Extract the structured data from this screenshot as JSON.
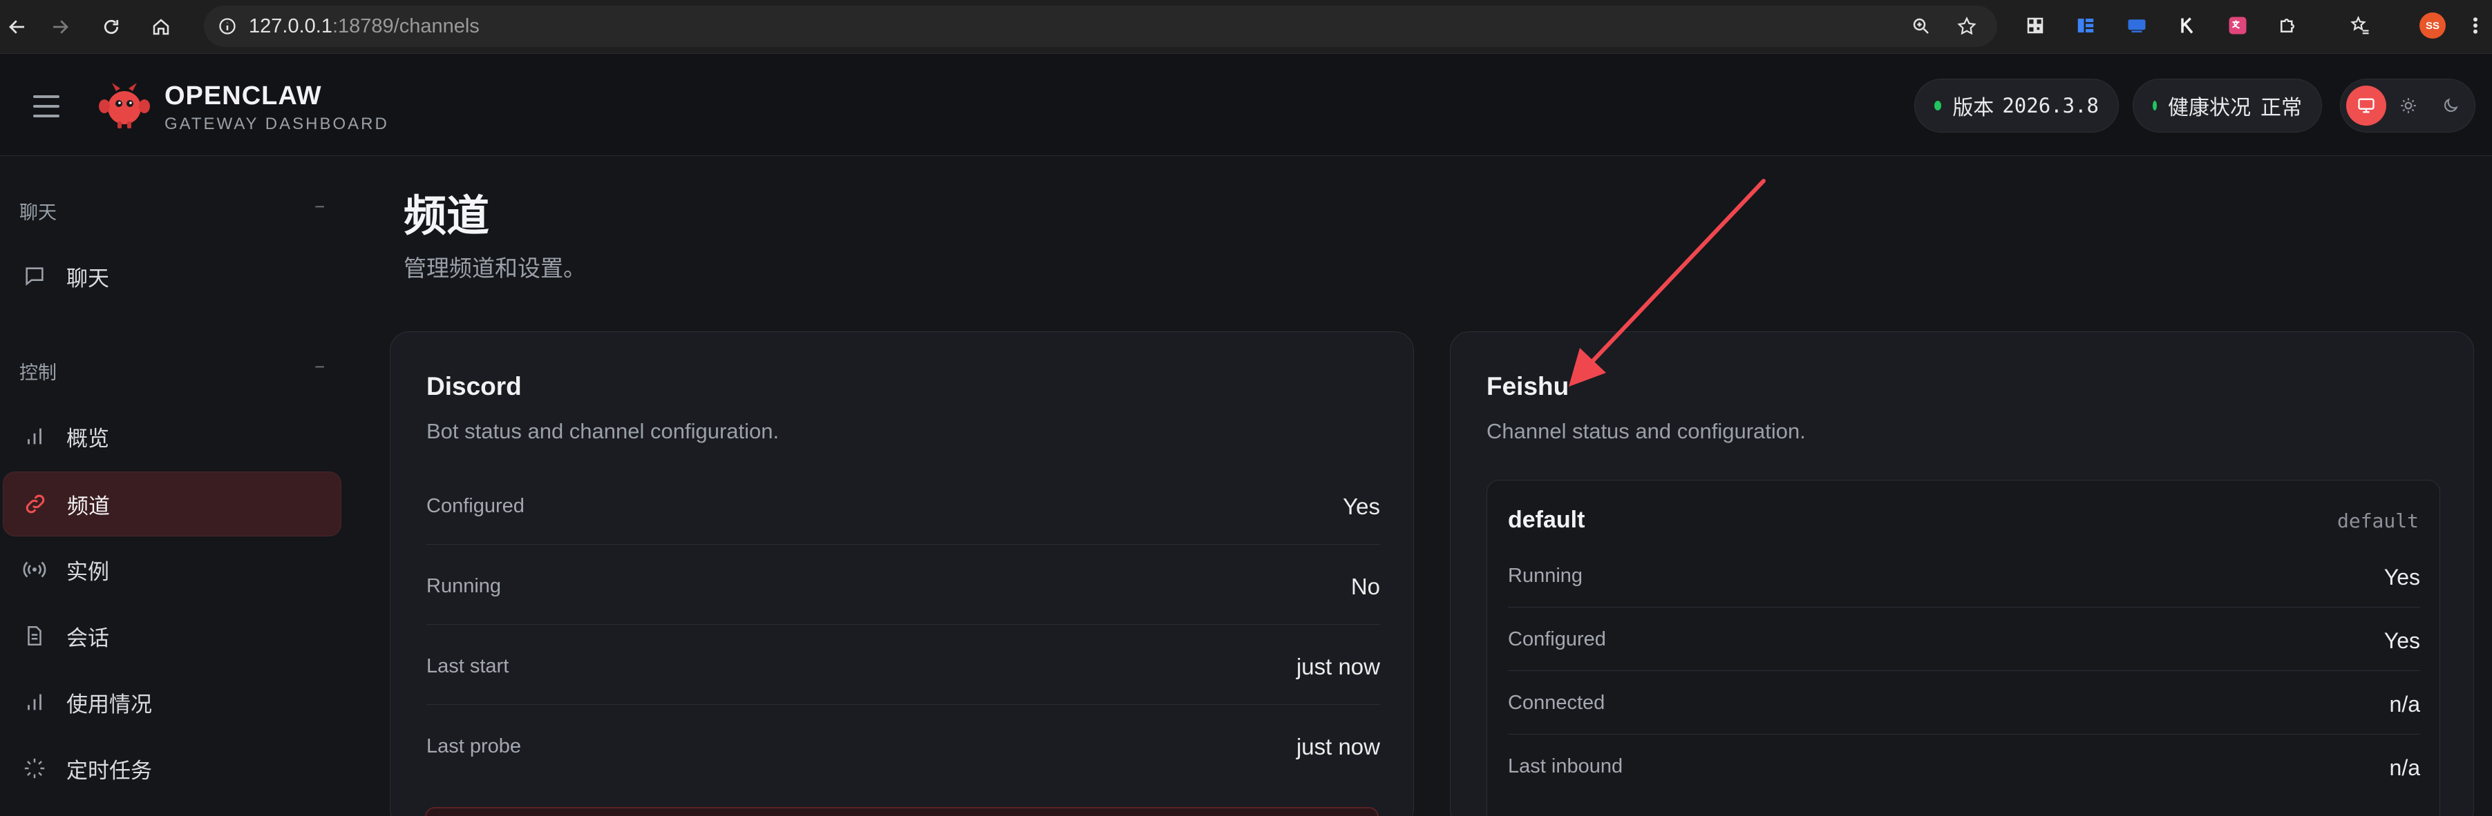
{
  "browser": {
    "url_host": "127.0.0.1",
    "url_path": ":18789/channels",
    "profile_initials": "SS"
  },
  "header": {
    "brand_title": "OPENCLAW",
    "brand_subtitle": "GATEWAY DASHBOARD",
    "version_label": "版本",
    "version_value": "2026.3.8",
    "health_label": "健康状况",
    "health_value": "正常"
  },
  "sidebar": {
    "sections": [
      {
        "title": "聊天",
        "collapse": "−",
        "items": [
          {
            "label": "聊天",
            "icon": "message-icon"
          }
        ]
      },
      {
        "title": "控制",
        "collapse": "−",
        "items": [
          {
            "label": "概览",
            "icon": "bar-chart-icon"
          },
          {
            "label": "频道",
            "icon": "link-icon",
            "active": true
          },
          {
            "label": "实例",
            "icon": "broadcast-icon"
          },
          {
            "label": "会话",
            "icon": "document-icon"
          },
          {
            "label": "使用情况",
            "icon": "bar-chart-icon"
          },
          {
            "label": "定时任务",
            "icon": "loader-icon"
          }
        ]
      }
    ]
  },
  "main": {
    "title": "频道",
    "subtitle": "管理频道和设置。",
    "discord": {
      "title": "Discord",
      "description": "Bot status and channel configuration.",
      "rows": [
        {
          "key": "Configured",
          "value": "Yes"
        },
        {
          "key": "Running",
          "value": "No"
        },
        {
          "key": "Last start",
          "value": "just now"
        },
        {
          "key": "Last probe",
          "value": "just now"
        }
      ]
    },
    "feishu": {
      "title": "Feishu",
      "description": "Channel status and configuration.",
      "account": {
        "name": "default",
        "tag": "default",
        "rows": [
          {
            "key": "Running",
            "value": "Yes"
          },
          {
            "key": "Configured",
            "value": "Yes"
          },
          {
            "key": "Connected",
            "value": "n/a"
          },
          {
            "key": "Last inbound",
            "value": "n/a"
          }
        ]
      }
    }
  },
  "colors": {
    "accent": "#ef4f4f",
    "status_ok": "#22c55e",
    "annotation_arrow": "#f0474f"
  }
}
